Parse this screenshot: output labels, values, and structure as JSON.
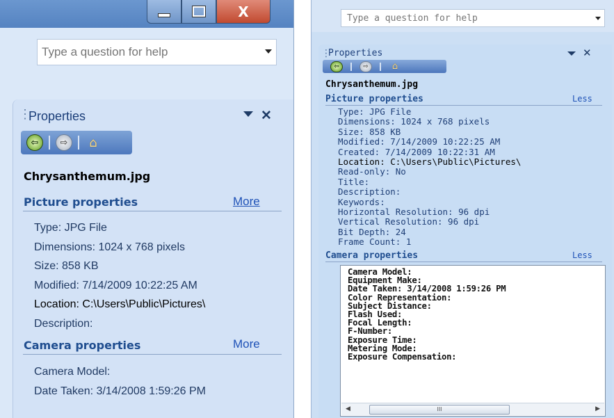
{
  "left": {
    "window": {
      "minimize_label": "",
      "maximize_label": "",
      "close_label": "X"
    },
    "help": {
      "placeholder": "Type a question for help"
    },
    "pane": {
      "title": "Properties",
      "filename": "Chrysanthemum.jpg",
      "picture_section": {
        "title": "Picture properties",
        "link": "More"
      },
      "picture_items": [
        "Type: JPG File",
        "Dimensions: 1024 x 768 pixels",
        "Size: 858 KB",
        "Modified: 7/14/2009 10:22:25 AM",
        "Location:   C:\\Users\\Public\\Pictures\\",
        "Description:"
      ],
      "camera_section": {
        "title": "Camera properties",
        "link": "More"
      },
      "camera_items": [
        "Camera Model:",
        "Date Taken: 3/14/2008 1:59:26 PM"
      ]
    }
  },
  "right": {
    "help": {
      "placeholder": "Type a question for help"
    },
    "pane": {
      "title": "Properties",
      "filename": "Chrysanthemum.jpg",
      "picture_section": {
        "title": "Picture properties",
        "link": "Less"
      },
      "picture_items": [
        "Type: JPG File",
        "Dimensions: 1024 x 768 pixels",
        "Size: 858 KB",
        "Modified: 7/14/2009 10:22:25 AM",
        "Created: 7/14/2009 10:22:31 AM",
        "Location:   C:\\Users\\Public\\Pictures\\",
        "Read-only: No",
        "Title:",
        "Description:",
        "Keywords:",
        "Horizontal Resolution: 96 dpi",
        "Vertical Resolution: 96 dpi",
        "Bit Depth: 24",
        "Frame Count: 1"
      ],
      "camera_section": {
        "title": "Camera properties",
        "link": "Less"
      },
      "camera_items": [
        "Camera Model:",
        "Equipment Make:",
        "Date Taken: 3/14/2008 1:59:26 PM",
        "Color Representation:",
        "Subject Distance:",
        "Flash Used:",
        "Focal Length:",
        "F-Number:",
        "Exposure Time:",
        "Metering Mode:",
        "Exposure Compensation:"
      ],
      "scroll_thumb_label": "III"
    }
  },
  "icons": {
    "back": "back-arrow-icon",
    "forward": "forward-arrow-icon",
    "home": "home-icon",
    "pane_menu": "dropdown-triangle-icon",
    "pane_close": "close-icon",
    "grip": "drag-grip-icon"
  },
  "colors": {
    "pane_bg": "#d3e2f6",
    "section_title": "#1f4d8f",
    "link": "#1f52b7",
    "property_text": "#203a63",
    "titlebar": "#5583c1",
    "close_button": "#c14a30"
  }
}
